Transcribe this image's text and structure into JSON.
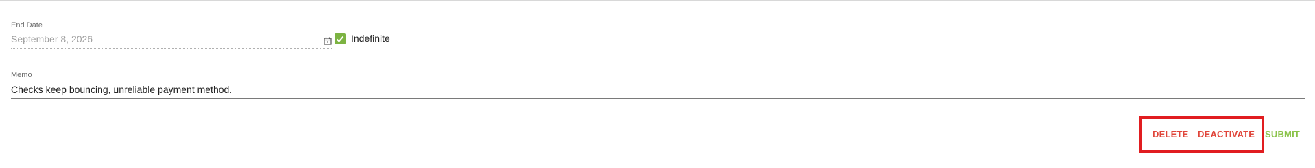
{
  "form": {
    "end_date": {
      "label": "End Date",
      "value": "September 8, 2026",
      "calendar_icon": "calendar-icon"
    },
    "indefinite": {
      "label": "Indefinite",
      "checked": true,
      "color": "#7cb342"
    },
    "memo": {
      "label": "Memo",
      "value": "Checks keep bouncing, unreliable payment method."
    }
  },
  "actions": {
    "delete_label": "DELETE",
    "deactivate_label": "DEACTIVATE",
    "submit_label": "SUBMIT",
    "danger_color": "#e0453a",
    "submit_color": "#8bc34a",
    "highlight_color": "#e11d20"
  }
}
